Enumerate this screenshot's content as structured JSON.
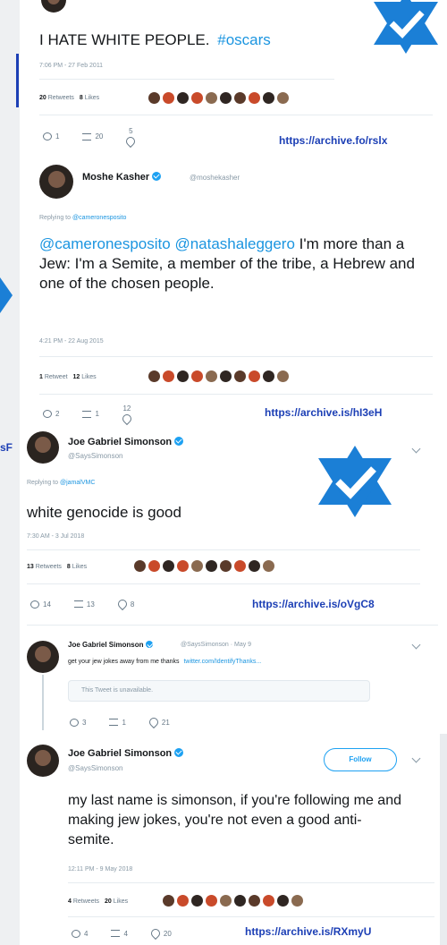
{
  "tweet1": {
    "text_plain": "I HATE WHITE PEOPLE.",
    "hashtag": "#oscars",
    "timestamp": "7:06 PM - 27 Feb 2011",
    "retweets_count": "20",
    "retweets_label": "Retweets",
    "likes_count": "8",
    "likes_label": "Likes",
    "reply_count": "1",
    "retweet_action_count": "20",
    "like_action_count": "5",
    "archive_url": "https://archive.fo/rslx"
  },
  "tweet2": {
    "name": "Moshe Kasher",
    "handle": "@moshekasher",
    "replying_label": "Replying to",
    "replying_mentions": "@cameronesposito",
    "mention1": "@cameronesposito",
    "mention2": "@natashaleggero",
    "text_rest": "I'm more than a Jew: I'm a Semite, a member of the tribe, a Hebrew and one of the chosen people.",
    "timestamp": "4:21 PM - 22 Aug 2015",
    "retweets_count": "1",
    "retweets_label": "Retweet",
    "likes_count": "12",
    "likes_label": "Likes",
    "reply_count": "2",
    "retweet_action_count": "1",
    "like_action_count": "12",
    "archive_url": "https://archive.is/hI3eH"
  },
  "tweet3": {
    "name": "Joe Gabriel Simonson",
    "handle": "@SaysSimonson",
    "replying_label": "Replying to",
    "replying_mentions": "@jamalVMC",
    "text": "white genocide is good",
    "timestamp": "7:30 AM - 3 Jul 2018",
    "retweets_count": "13",
    "retweets_label": "Retweets",
    "likes_count": "8",
    "likes_label": "Likes",
    "reply_count": "14",
    "retweet_action_count": "13",
    "like_action_count": "8",
    "archive_url": "https://archive.is/oVgC8"
  },
  "tweet4": {
    "name": "Joe Gabriel Simonson",
    "handle": "@SaysSimonson · May 9",
    "text": "get your jew jokes away from me thanks",
    "link": "twitter.com/IdentifyThanks...",
    "quoted_unavailable": "This Tweet is unavailable.",
    "reply_count": "3",
    "retweet_action_count": "1",
    "like_action_count": "21"
  },
  "tweet5": {
    "name": "Joe Gabriel Simonson",
    "handle": "@SaysSimonson",
    "follow_label": "Follow",
    "text": "my last name is simonson, if you're following me and making jew jokes, you're not even a good anti-semite.",
    "timestamp": "12:11 PM - 9 May 2018",
    "retweets_count": "4",
    "retweets_label": "Retweets",
    "likes_count": "20",
    "likes_label": "Likes",
    "reply_count": "4",
    "retweet_action_count": "4",
    "like_action_count": "20",
    "archive_url": "https://archive.is/RXmyU"
  },
  "side_fragments": {
    "left_text": "sF"
  },
  "colors": {
    "star_blue": "#1b7fd6",
    "link_blue": "#1c3fb5",
    "mention_blue": "#1b95e0",
    "verified_blue": "#1da1f2"
  }
}
